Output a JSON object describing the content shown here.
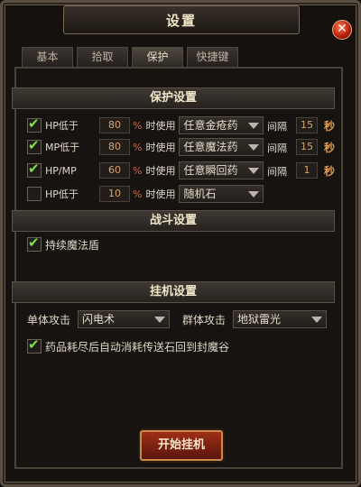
{
  "title": "设置",
  "close_glyph": "✕",
  "tabs": [
    "基本",
    "拾取",
    "保护",
    "快捷键"
  ],
  "active_tab": "保护",
  "protection": {
    "header": "保护设置",
    "rows": [
      {
        "checked": true,
        "label": "HP低于",
        "percent": "80",
        "pct_sign": "%",
        "use_text": "时使用",
        "item": "任意金疮药",
        "interval_label": "间隔",
        "interval": "15",
        "unit": "秒"
      },
      {
        "checked": true,
        "label": "MP低于",
        "percent": "80",
        "pct_sign": "%",
        "use_text": "时使用",
        "item": "任意魔法药",
        "interval_label": "间隔",
        "interval": "15",
        "unit": "秒"
      },
      {
        "checked": true,
        "label": "HP/MP",
        "percent": "60",
        "pct_sign": "%",
        "use_text": "时使用",
        "item": "任意瞬回药",
        "interval_label": "间隔",
        "interval": "1",
        "unit": "秒"
      },
      {
        "checked": false,
        "label": "HP低于",
        "percent": "10",
        "pct_sign": "%",
        "use_text": "时使用",
        "item": "随机石"
      }
    ]
  },
  "combat": {
    "header": "战斗设置",
    "option": {
      "checked": true,
      "label": "持续魔法盾"
    }
  },
  "hangup": {
    "header": "挂机设置",
    "single_label": "单体攻击",
    "single_value": "闪电术",
    "group_label": "群体攻击",
    "group_value": "地狱雷光",
    "option": {
      "checked": true,
      "label": "药品耗尽后自动消耗传送石回到封魔谷"
    }
  },
  "start_button": "开始挂机",
  "colors": {
    "accent_check": "#7ee04a",
    "seconds": "#e29a4c",
    "button": "#9e2f17"
  }
}
